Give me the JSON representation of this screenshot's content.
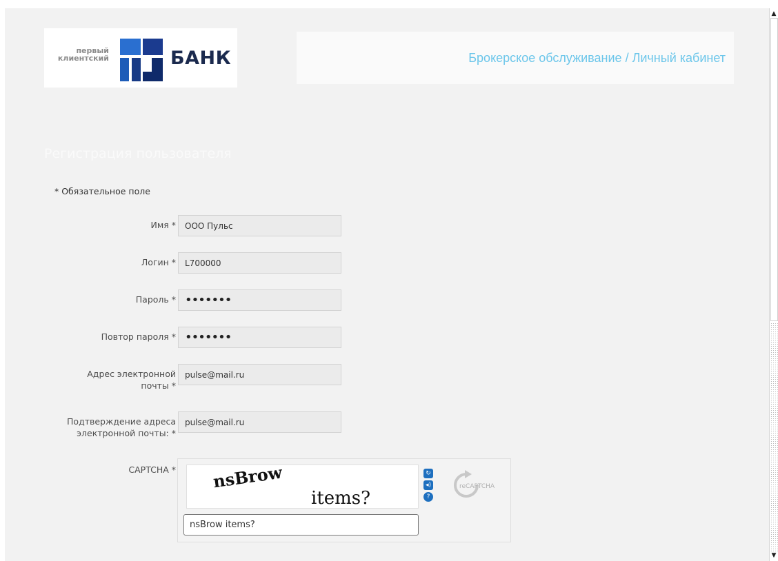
{
  "header": {
    "logo_small": "первый\nклиентский",
    "logo_bank": "БАНК",
    "nav_link": "Брокерское обслуживание / Личный кабинет"
  },
  "form": {
    "title": "Регистрация пользователя",
    "required_note": "* Обязательное поле",
    "fields": [
      {
        "label": "Имя *",
        "value": "ООО Пульс"
      },
      {
        "label": "Логин *",
        "value": "L700000"
      },
      {
        "label": "Пароль *",
        "value": "•••••••"
      },
      {
        "label": "Повтор пароля *",
        "value": "•••••••"
      },
      {
        "label": "Адрес электронной почты *",
        "value": "pulse@mail.ru"
      },
      {
        "label": "Подтверждение адреса электронной почты: *",
        "value": "pulse@mail.ru"
      }
    ],
    "captcha": {
      "label": "CAPTCHA *",
      "word1": "nsBrow",
      "word2": "items?",
      "input_value": "nsBrow items?",
      "brand": "reCAPTCHA",
      "refresh_icon": "refresh-icon",
      "audio_icon": "audio-icon",
      "help_icon": "help-icon"
    }
  },
  "colors": {
    "accent_link": "#6cc6ea",
    "brand_navy": "#1b2a4e",
    "brand_blue": "#1d5cb8",
    "page_bg": "#f2f2f2"
  }
}
